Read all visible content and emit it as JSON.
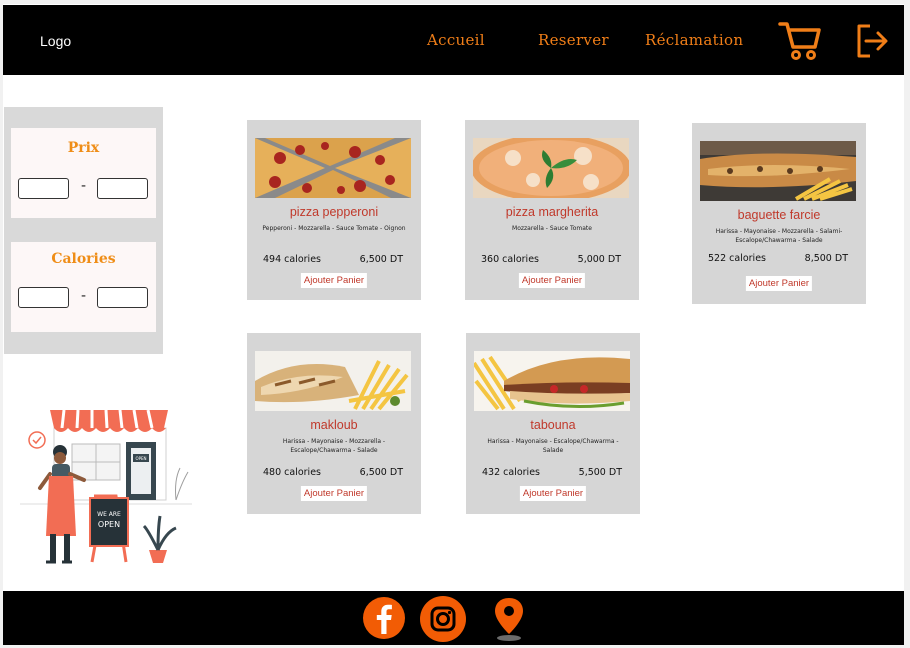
{
  "header": {
    "logo": "Logo",
    "nav": [
      "Accueil",
      "Reserver",
      "Réclamation"
    ],
    "cart_icon": "cart-icon",
    "logout_icon": "logout-icon"
  },
  "filters": {
    "price_title": "Prix",
    "calories_title": "Calories",
    "range_separator": "-"
  },
  "products": [
    {
      "name": "pizza pepperoni",
      "ingredients": "Pepperoni - Mozzarella - Sauce Tomate - Oignon",
      "calories": "494 calories",
      "price": "6,500 DT",
      "add_label": "Ajouter Panier"
    },
    {
      "name": "pizza margherita",
      "ingredients": "Mozzarella - Sauce Tomate",
      "calories": "360 calories",
      "price": "5,000 DT",
      "add_label": "Ajouter Panier"
    },
    {
      "name": "baguette farcie",
      "ingredients": "Harissa - Mayonaise - Mozzarella - Salami- Escalope/Chawarma - Salade",
      "calories": "522 calories",
      "price": "8,500 DT",
      "add_label": "Ajouter Panier"
    },
    {
      "name": "makloub",
      "ingredients": "Harissa - Mayonaise - Mozzarella - Escalope/Chawarma - Salade",
      "calories": "480 calories",
      "price": "6,500 DT",
      "add_label": "Ajouter Panier"
    },
    {
      "name": "tabouna",
      "ingredients": "Harissa - Mayonaise - Escalope/Chawarma - Salade",
      "calories": "432 calories",
      "price": "5,500 DT",
      "add_label": "Ajouter Panier"
    }
  ],
  "illustration": {
    "sign_text": "WE ARE OPEN",
    "door_sign": "OPEN"
  },
  "footer": {
    "icons": [
      "facebook-icon",
      "instagram-icon",
      "location-pin-icon"
    ]
  },
  "colors": {
    "accent": "#f07e18",
    "product_name": "#c0392b",
    "card_bg": "#d6d6d6",
    "bar_bg": "#000000"
  }
}
